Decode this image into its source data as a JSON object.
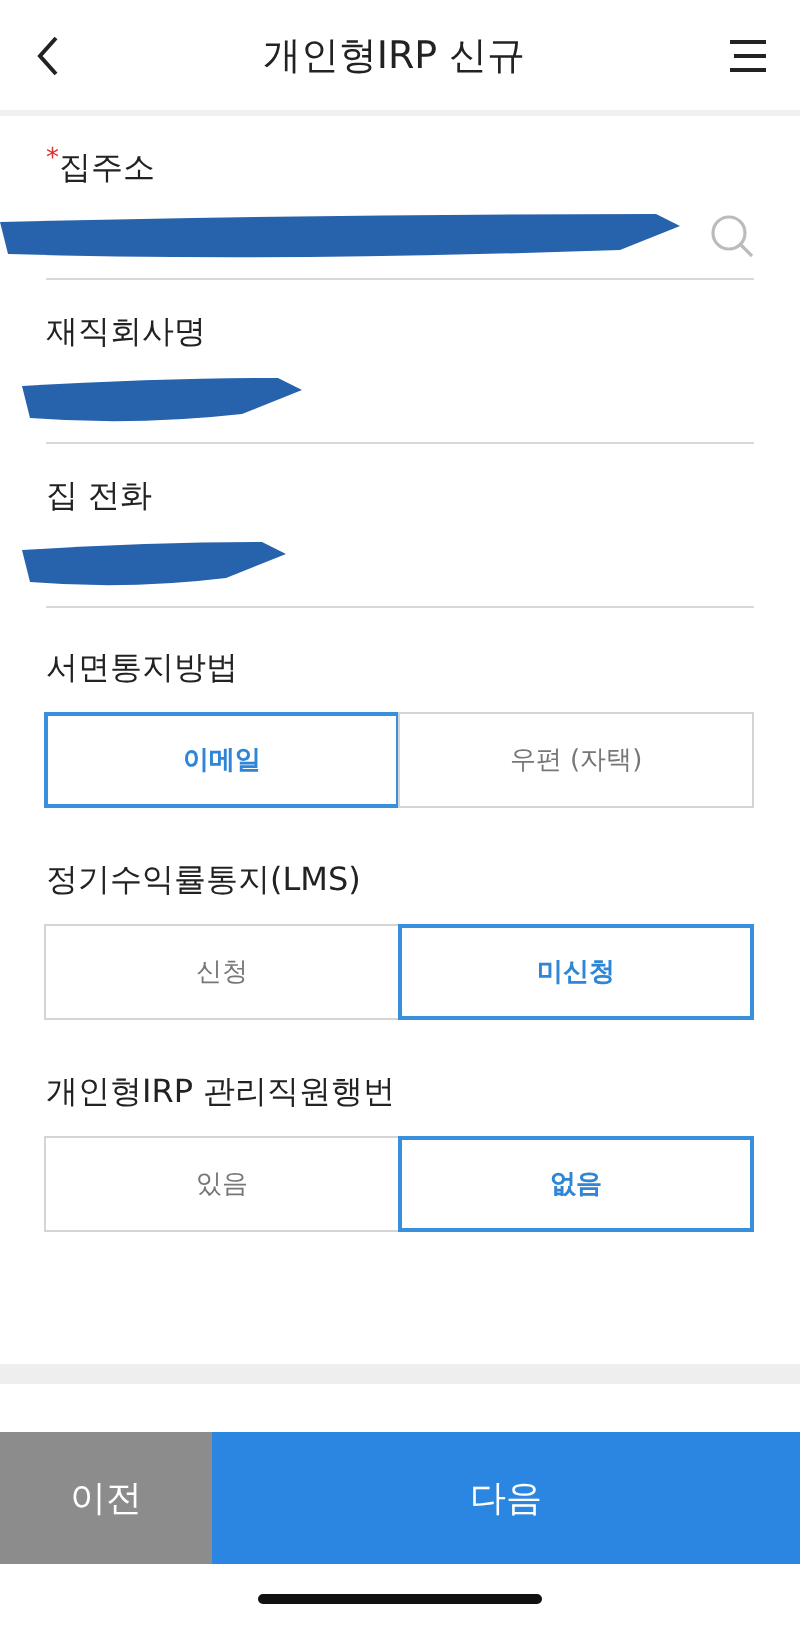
{
  "header": {
    "title": "개인형IRP 신규"
  },
  "fields": [
    {
      "label": "집주소",
      "required_mark": "*",
      "redacted": true,
      "kind": "search"
    },
    {
      "label": "재직회사명",
      "redacted": true,
      "kind": "text"
    },
    {
      "label": "집 전화",
      "redacted": true,
      "kind": "text"
    }
  ],
  "choice_groups": [
    {
      "label": "서면통지방법",
      "options": [
        {
          "label": "이메일",
          "selected": true
        },
        {
          "label": "우편 (자택)",
          "selected": false
        }
      ]
    },
    {
      "label": "정기수익률통지(LMS)",
      "options": [
        {
          "label": "신청",
          "selected": false
        },
        {
          "label": "미신청",
          "selected": true
        }
      ]
    },
    {
      "label": "개인형IRP 관리직원행번",
      "options": [
        {
          "label": "있음",
          "selected": false
        },
        {
          "label": "없음",
          "selected": true
        }
      ]
    }
  ],
  "footer": {
    "prev": "이전",
    "next": "다음"
  }
}
